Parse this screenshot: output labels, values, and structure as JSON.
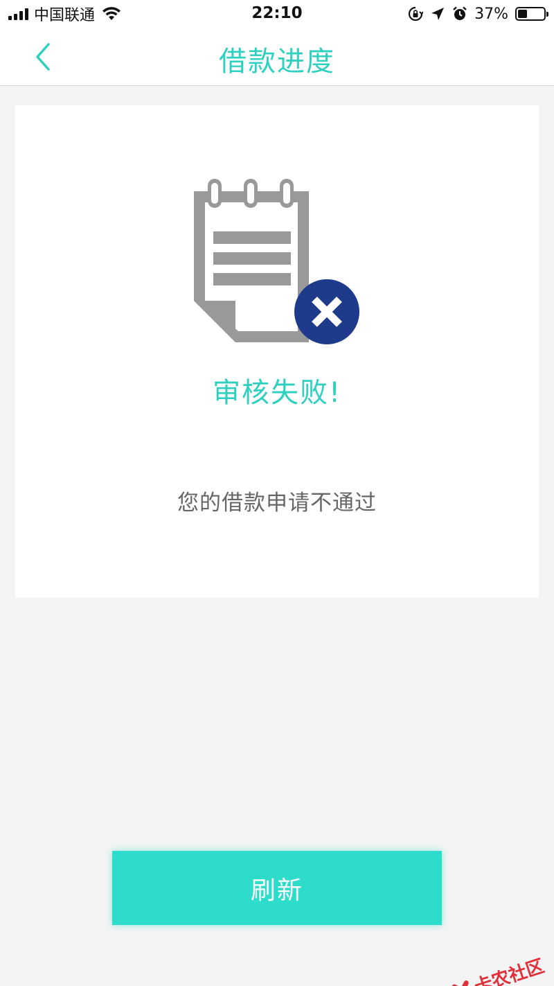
{
  "status_bar": {
    "carrier": "中国联通",
    "time": "22:10",
    "battery_percent": "37%",
    "battery_level": 0.37
  },
  "nav": {
    "title": "借款进度",
    "back_icon": "chevron-left-icon"
  },
  "result": {
    "illustration_icon": "notepad-rejected-icon",
    "title": "审核失败!",
    "message": "您的借款申请不通过"
  },
  "actions": {
    "refresh_label": "刷新"
  },
  "watermark": {
    "text": "卡农社区"
  },
  "colors": {
    "accent": "#2fd0c0",
    "button": "#2ddccb",
    "reject_badge": "#1e3a8a",
    "icon_gray": "#999999",
    "background": "#f4f4f4"
  }
}
